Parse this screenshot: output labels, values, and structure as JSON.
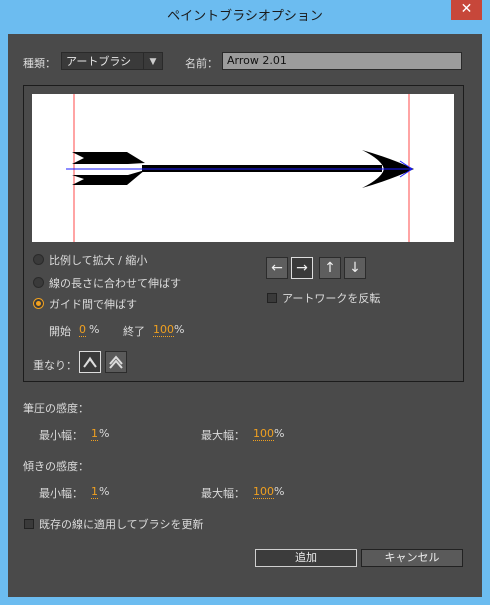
{
  "window": {
    "title": "ペイントブラシオプション",
    "close_glyph": "✕"
  },
  "type": {
    "label": "種類：",
    "value": "アートブラシ"
  },
  "name": {
    "label": "名前：",
    "value": "Arrow 2.01"
  },
  "scale_options": {
    "items": [
      {
        "label": "比例して拡大 / 縮小",
        "selected": false
      },
      {
        "label": "線の長さに合わせて伸ばす",
        "selected": false
      },
      {
        "label": "ガイド間で伸ばす",
        "selected": true
      }
    ],
    "start_label": "開始",
    "start_value": "0",
    "end_label": "終了",
    "end_value": "100",
    "unit": "%"
  },
  "direction": {
    "buttons": [
      "←",
      "→",
      "↑",
      "↓"
    ],
    "selected": 1,
    "flip_label": "アートワークを反転"
  },
  "overlap": {
    "label": "重なり："
  },
  "pressure": {
    "heading": "筆圧の感度：",
    "min_label": "最小幅：",
    "min_value": "1",
    "max_label": "最大幅：",
    "max_value": "100",
    "unit": "%"
  },
  "tilt": {
    "heading": "傾きの感度：",
    "min_label": "最小幅：",
    "min_value": "1",
    "max_label": "最大幅：",
    "max_value": "100",
    "unit": "%"
  },
  "apply_existing": {
    "label": "既存の線に適用してブラシを更新"
  },
  "buttons": {
    "add": "追加",
    "cancel": "キャンセル"
  },
  "colors": {
    "accent": "#f0a020",
    "guide": "#ff4a4a",
    "path": "#1a1aff"
  }
}
